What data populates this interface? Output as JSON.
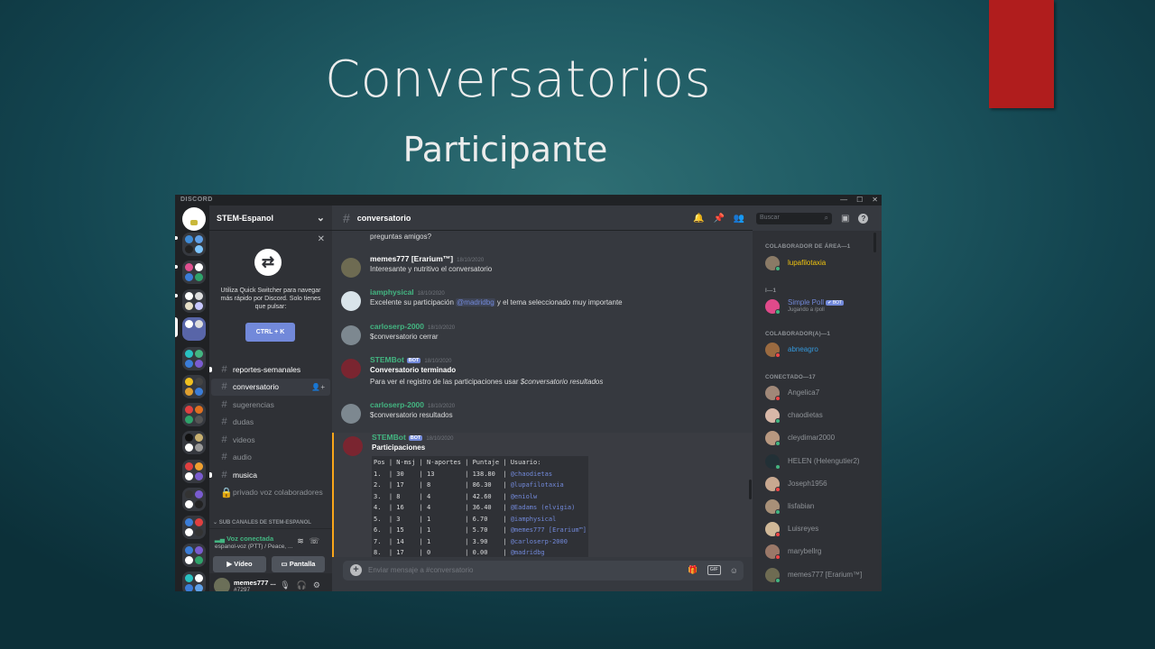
{
  "slide": {
    "title": "Conversatorios",
    "subtitle": "Participante",
    "accent_color": "#b01d1d"
  },
  "window": {
    "brand": "DISCORD",
    "minimize": "—",
    "maximize": "☐",
    "close": "✕"
  },
  "server": {
    "name": "STEM-Espanol",
    "chevron": "⌄"
  },
  "quick_switcher": {
    "close": "✕",
    "icon": "⇄",
    "text": "Utiliza Quick Switcher para navegar más rápido por Discord. Solo tienes que pulsar:",
    "button": "CTRL + K"
  },
  "channels": [
    {
      "name": "reportes-semanales",
      "state": "bright",
      "unread": true
    },
    {
      "name": "conversatorio",
      "state": "active",
      "unread": false
    },
    {
      "name": "sugerencias",
      "state": "muted",
      "unread": false
    },
    {
      "name": "dudas",
      "state": "muted",
      "unread": false
    },
    {
      "name": "videos",
      "state": "muted",
      "unread": false
    },
    {
      "name": "audio",
      "state": "muted",
      "unread": false
    },
    {
      "name": "musica",
      "state": "bright",
      "unread": true
    },
    {
      "name": "privado voz colaboradores",
      "state": "muted",
      "unread": false
    }
  ],
  "sub_category": "⌄ SUB CANALES DE STEM-ESPANOL",
  "voice": {
    "status": "Voz conectada",
    "detail": "espanol-voz (PTT) / Peace, ...",
    "video_label": "Vídeo",
    "screen_label": "Pantalla"
  },
  "user": {
    "name": "memes777 ...",
    "tag": "#7297"
  },
  "chat": {
    "channel": "conversatorio",
    "input_placeholder": "Enviar mensaje a #conversatorio",
    "partial_top": "preguntas amigos?",
    "messages": [
      {
        "author": "memes777 [Erarium™]",
        "color": "#ffffff",
        "ts": "18/10/2020",
        "body": "Interesante y nutritivo el conversatorio"
      },
      {
        "author": "iamphysical",
        "color": "#43b581",
        "ts": "18/10/2020",
        "body_pre": "Excelente su participación ",
        "mention": "@madridbg",
        "body_post": " y el tema seleccionado muy importante"
      },
      {
        "author": "carloserp-2000",
        "color": "#43b581",
        "ts": "18/10/2020",
        "body": "$conversatorio cerrar"
      },
      {
        "author": "STEMBot",
        "color": "#43b581",
        "ts": "18/10/2020",
        "bot": "BOT",
        "title": "Conversatorio terminado",
        "body_pre": "Para ver el registro de las participaciones usar ",
        "body_em": "$conversatorio resultados"
      },
      {
        "author": "carloserp-2000",
        "color": "#43b581",
        "ts": "18/10/2020",
        "body": "$conversatorio resultados"
      },
      {
        "author": "STEMBot",
        "color": "#43b581",
        "ts": "18/10/2020",
        "bot": "BOT",
        "title": "Participaciones"
      }
    ],
    "results_header": "Pos | N-msj | N-aportes | Puntaje | Usuario:",
    "results": [
      {
        "pos": "1.",
        "msj": "30",
        "aportes": "13",
        "puntaje": "138.80",
        "usuario": "@chaodietas"
      },
      {
        "pos": "2.",
        "msj": "17",
        "aportes": "8",
        "puntaje": "86.30",
        "usuario": "@lupafilotaxia"
      },
      {
        "pos": "3.",
        "msj": "8",
        "aportes": "4",
        "puntaje": "42.60",
        "usuario": "@eniolw"
      },
      {
        "pos": "4.",
        "msj": "16",
        "aportes": "4",
        "puntaje": "36.40",
        "usuario": "@Eadams (elvigia)"
      },
      {
        "pos": "5.",
        "msj": "3",
        "aportes": "1",
        "puntaje": "6.70",
        "usuario": "@iamphysical"
      },
      {
        "pos": "6.",
        "msj": "15",
        "aportes": "1",
        "puntaje": "5.70",
        "usuario": "@memes777 [Erarium™]"
      },
      {
        "pos": "7.",
        "msj": "14",
        "aportes": "1",
        "puntaje": "3.90",
        "usuario": "@carloserp-2000"
      },
      {
        "pos": "8.",
        "msj": "17",
        "aportes": "0",
        "puntaje": "0.00",
        "usuario": "@madridbg"
      }
    ]
  },
  "search": {
    "placeholder": "Buscar",
    "icon": "⌕"
  },
  "members": {
    "cat1": "COLABORADOR DE ÁREA—1",
    "cat2": "I—1",
    "cat3": "COLABORADOR(A)—1",
    "cat4": "CONECTADO—17",
    "area": {
      "name": "lupafilotaxia",
      "color": "#f1c40f"
    },
    "bot": {
      "name": "Simple Poll",
      "tag": "✔ BOT",
      "sub": "Jugando a /poll",
      "color": "#7289da"
    },
    "colab": {
      "name": "abneagro",
      "color": "#3498db"
    },
    "online": [
      "Angelica7",
      "chaodietas",
      "cleydimar2000",
      "HELEN (Helengutier2)",
      "Joseph1956",
      "lisfabian",
      "Luisreyes",
      "marybellrg",
      "memes777 [Erarium™]"
    ]
  }
}
